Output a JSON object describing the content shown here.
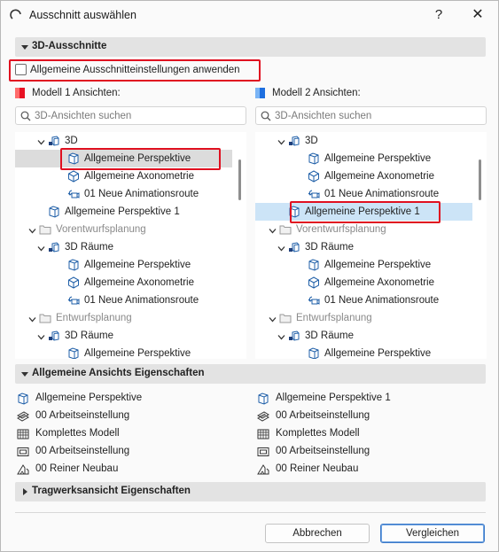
{
  "window": {
    "title": "Ausschnitt auswählen",
    "help_label": "?",
    "close_label": "✕"
  },
  "sections": {
    "views_3d": "3D-Ausschnitte",
    "general_props": "Allgemeine Ansichts Eigenschaften",
    "structural_props": "Tragwerksansicht Eigenschaften"
  },
  "apply_general": {
    "label": "Allgemeine Ausschnitteinstellungen anwenden",
    "checked": false
  },
  "model1": {
    "label": "Modell 1 Ansichten:",
    "colors": [
      "#ff6b6b",
      "#e81123"
    ],
    "search_placeholder": "3D-Ansichten suchen",
    "tree": [
      {
        "label": "3D",
        "icon": "view-3d-icon",
        "level": 1,
        "expander": true
      },
      {
        "label": "Allgemeine Perspektive",
        "icon": "perspective-cube-icon",
        "level": 2,
        "selected": true
      },
      {
        "label": "Allgemeine Axonometrie",
        "icon": "axonometry-cube-icon",
        "level": 2
      },
      {
        "label": "01 Neue Animationsroute",
        "icon": "animation-camera-icon",
        "level": 2
      },
      {
        "label": "Allgemeine Perspektive 1",
        "icon": "perspective-cube-icon",
        "level": 1
      },
      {
        "label": "Vorentwurfsplanung",
        "icon": "folder-icon",
        "level": 0,
        "expander": true,
        "dim": true
      },
      {
        "label": "3D Räume",
        "icon": "view-3d-icon",
        "level": 1,
        "expander": true
      },
      {
        "label": "Allgemeine Perspektive",
        "icon": "perspective-cube-icon",
        "level": 2
      },
      {
        "label": "Allgemeine Axonometrie",
        "icon": "axonometry-cube-icon",
        "level": 2
      },
      {
        "label": "01 Neue Animationsroute",
        "icon": "animation-camera-icon",
        "level": 2
      },
      {
        "label": "Entwurfsplanung",
        "icon": "folder-icon",
        "level": 0,
        "expander": true,
        "dim": true
      },
      {
        "label": "3D Räume",
        "icon": "view-3d-icon",
        "level": 1,
        "expander": true
      },
      {
        "label": "Allgemeine Perspektive",
        "icon": "perspective-cube-icon",
        "level": 2
      }
    ],
    "properties": [
      {
        "label": "Allgemeine Perspektive",
        "icon": "perspective-cube-icon"
      },
      {
        "label": "00 Arbeitseinstellung",
        "icon": "layer-combination-icon"
      },
      {
        "label": "Komplettes Modell",
        "icon": "model-view-icon"
      },
      {
        "label": "00 Arbeitseinstellung",
        "icon": "display-options-icon"
      },
      {
        "label": "00 Reiner Neubau",
        "icon": "renovation-filter-icon"
      }
    ]
  },
  "model2": {
    "label": "Modell 2 Ansichten:",
    "colors": [
      "#7ab4f5",
      "#1e6fe0"
    ],
    "search_placeholder": "3D-Ansichten suchen",
    "tree": [
      {
        "label": "3D",
        "icon": "view-3d-icon",
        "level": 1,
        "expander": true
      },
      {
        "label": "Allgemeine Perspektive",
        "icon": "perspective-cube-icon",
        "level": 2
      },
      {
        "label": "Allgemeine Axonometrie",
        "icon": "axonometry-cube-icon",
        "level": 2
      },
      {
        "label": "01 Neue Animationsroute",
        "icon": "animation-camera-icon",
        "level": 2
      },
      {
        "label": "Allgemeine Perspektive 1",
        "icon": "perspective-cube-icon",
        "level": 1,
        "selected": true
      },
      {
        "label": "Vorentwurfsplanung",
        "icon": "folder-icon",
        "level": 0,
        "expander": true,
        "dim": true
      },
      {
        "label": "3D Räume",
        "icon": "view-3d-icon",
        "level": 1,
        "expander": true
      },
      {
        "label": "Allgemeine Perspektive",
        "icon": "perspective-cube-icon",
        "level": 2
      },
      {
        "label": "Allgemeine Axonometrie",
        "icon": "axonometry-cube-icon",
        "level": 2
      },
      {
        "label": "01 Neue Animationsroute",
        "icon": "animation-camera-icon",
        "level": 2
      },
      {
        "label": "Entwurfsplanung",
        "icon": "folder-icon",
        "level": 0,
        "expander": true,
        "dim": true
      },
      {
        "label": "3D Räume",
        "icon": "view-3d-icon",
        "level": 1,
        "expander": true
      },
      {
        "label": "Allgemeine Perspektive",
        "icon": "perspective-cube-icon",
        "level": 2
      }
    ],
    "properties": [
      {
        "label": "Allgemeine Perspektive 1",
        "icon": "perspective-cube-icon"
      },
      {
        "label": "00 Arbeitseinstellung",
        "icon": "layer-combination-icon"
      },
      {
        "label": "Komplettes Modell",
        "icon": "model-view-icon"
      },
      {
        "label": "00 Arbeitseinstellung",
        "icon": "display-options-icon"
      },
      {
        "label": "00 Reiner Neubau",
        "icon": "renovation-filter-icon"
      }
    ]
  },
  "buttons": {
    "cancel": "Abbrechen",
    "compare": "Vergleichen"
  },
  "colors": {
    "highlight": "#e01020",
    "selection_grey": "#dcdcdc",
    "selection_blue": "#cce4f7",
    "accent": "#3d7ac9"
  }
}
